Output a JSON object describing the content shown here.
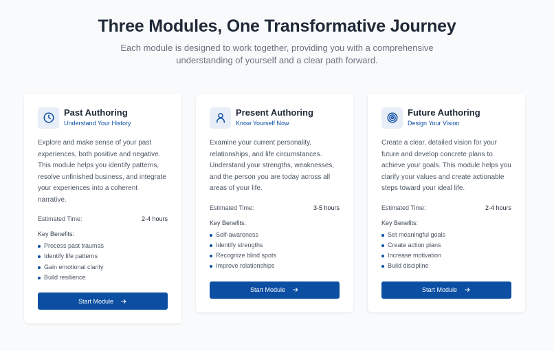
{
  "header": {
    "title": "Three Modules, One Transformative Journey",
    "subtitle": "Each module is designed to work together, providing you with a comprehensive understanding of yourself and a clear path forward."
  },
  "colors": {
    "accent": "#0b4ea2",
    "icon_bg": "#e8eef7",
    "page_bg": "#f9fafb"
  },
  "modules": [
    {
      "icon": "clock-icon",
      "title": "Past Authoring",
      "subtitle": "Understand Your History",
      "description": "Explore and make sense of your past experiences, both positive and negative. This module helps you identify patterns, resolve unfinished business, and integrate your experiences into a coherent narrative.",
      "estimated_label": "Estimated Time:",
      "estimated_value": "2-4 hours",
      "benefits_label": "Key Benefits:",
      "benefits": [
        "Process past traumas",
        "Identify life patterns",
        "Gain emotional clarity",
        "Build resilience"
      ],
      "button_label": "Start Module"
    },
    {
      "icon": "user-icon",
      "title": "Present Authoring",
      "subtitle": "Know Yourself Now",
      "description": "Examine your current personality, relationships, and life circumstances. Understand your strengths, weaknesses, and the person you are today across all areas of your life.",
      "estimated_label": "Estimated Time:",
      "estimated_value": "3-5 hours",
      "benefits_label": "Key Benefits:",
      "benefits": [
        "Self-awareness",
        "Identify strengths",
        "Recognize blind spots",
        "Improve relationships"
      ],
      "button_label": "Start Module"
    },
    {
      "icon": "target-icon",
      "title": "Future Authoring",
      "subtitle": "Design Your Vision",
      "description": "Create a clear, detailed vision for your future and develop concrete plans to achieve your goals. This module helps you clarify your values and create actionable steps toward your ideal life.",
      "estimated_label": "Estimated Time:",
      "estimated_value": "2-4 hours",
      "benefits_label": "Key Benefits:",
      "benefits": [
        "Set meaningful goals",
        "Create action plans",
        "Increase motivation",
        "Build discipline"
      ],
      "button_label": "Start Module"
    }
  ]
}
